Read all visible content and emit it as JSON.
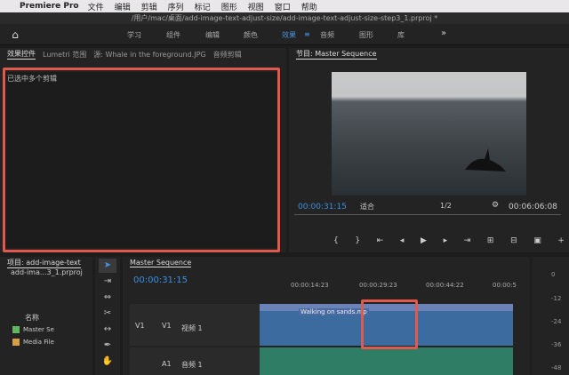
{
  "menubar": {
    "app_name": "Premiere Pro",
    "items": [
      "文件",
      "编辑",
      "剪辑",
      "序列",
      "标记",
      "图形",
      "视图",
      "窗口",
      "帮助"
    ]
  },
  "path": "/用户/mac/桌面/add-image-text-adjust-size/add-image-text-adjust-size-step3_1.prproj *",
  "workspaces": {
    "tabs": [
      "学习",
      "组件",
      "编辑",
      "颜色",
      "效果",
      "音频",
      "图形",
      "库"
    ],
    "active": "效果"
  },
  "effects_panel": {
    "tabs": [
      "效果控件",
      "Lumetri 范围",
      "源: Whale in the foreground.JPG",
      "音频剪辑"
    ],
    "message": "已选中多个剪辑"
  },
  "program": {
    "title": "节目: Master Sequence",
    "timecode_left": "00:00:31:15",
    "fit_label": "适合",
    "resolution": "1/2",
    "timecode_right": "00:06:06:08"
  },
  "project": {
    "title": "项目: add-image-text",
    "filename": "add-ima...3_1.prproj",
    "name_header": "名称",
    "items": [
      "Master Se",
      "Media File"
    ]
  },
  "timeline": {
    "title": "Master Sequence",
    "timecode": "00:00:31:15",
    "ruler": [
      "00:00:14:23",
      "00:00:29:23",
      "00:00:44:22",
      "00:00:5"
    ],
    "v1_label": "V1",
    "v1_name": "视频 1",
    "a1_label": "A1",
    "a1_name": "音频 1",
    "clip_name": "Walking on sands.mp"
  },
  "meter": [
    "0",
    "-12",
    "-24",
    "-36",
    "-48"
  ],
  "colors": {
    "accent": "#4a90e2",
    "highlight": "#e0594c"
  }
}
